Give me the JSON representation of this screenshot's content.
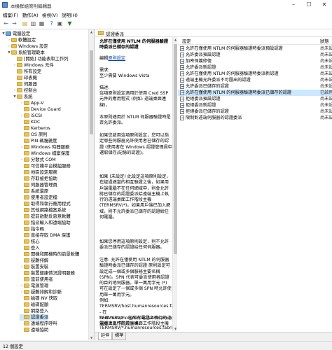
{
  "window": {
    "title": "本機群組原則編輯器"
  },
  "menu": [
    "檔案(F)",
    "動作(A)",
    "檢視(V)",
    "說明(H)"
  ],
  "tree": {
    "items": [
      {
        "label": "電腦設定",
        "level": 0,
        "exp": "▼",
        "icon": "pc"
      },
      {
        "label": "軟體設定",
        "level": 1,
        "exp": "›",
        "icon": "folder"
      },
      {
        "label": "Windows 設定",
        "level": 1,
        "exp": "›",
        "icon": "folder"
      },
      {
        "label": "系統管理範本",
        "level": 1,
        "exp": "▼",
        "icon": "folder"
      },
      {
        "label": "[開始] 功能表和工作列",
        "level": 2,
        "exp": "",
        "icon": "folder"
      },
      {
        "label": "Windows 元件",
        "level": 2,
        "exp": "›",
        "icon": "folder"
      },
      {
        "label": "所有設定",
        "level": 2,
        "exp": "",
        "icon": "folder"
      },
      {
        "label": "印表機",
        "level": 2,
        "exp": "",
        "icon": "folder"
      },
      {
        "label": "伺服器",
        "level": 2,
        "exp": "",
        "icon": "folder"
      },
      {
        "label": "控制台",
        "level": 2,
        "exp": "›",
        "icon": "folder"
      },
      {
        "label": "系統",
        "level": 2,
        "exp": "▼",
        "icon": "folder"
      },
      {
        "label": "App-V",
        "level": 3,
        "exp": "›",
        "icon": "folder"
      },
      {
        "label": "Device Guard",
        "level": 3,
        "exp": "",
        "icon": "folder"
      },
      {
        "label": "iSCSI",
        "level": 3,
        "exp": "›",
        "icon": "folder"
      },
      {
        "label": "KDC",
        "level": 3,
        "exp": "",
        "icon": "folder"
      },
      {
        "label": "Kerberos",
        "level": 3,
        "exp": "",
        "icon": "folder"
      },
      {
        "label": "OS 原則",
        "level": 3,
        "exp": "",
        "icon": "folder"
      },
      {
        "label": "PIN 碼複雜度",
        "level": 3,
        "exp": "",
        "icon": "folder"
      },
      {
        "label": "Windows 時間服務",
        "level": 3,
        "exp": "›",
        "icon": "folder"
      },
      {
        "label": "Windows 檔案保護",
        "level": 3,
        "exp": "",
        "icon": "folder"
      },
      {
        "label": "分散式 COM",
        "level": 3,
        "exp": "›",
        "icon": "folder"
      },
      {
        "label": "可信賴平台模組服務",
        "level": 3,
        "exp": "",
        "icon": "folder"
      },
      {
        "label": "地區設定服務",
        "level": 3,
        "exp": "",
        "icon": "folder"
      },
      {
        "label": "存取被拒協助",
        "level": 3,
        "exp": "",
        "icon": "folder"
      },
      {
        "label": "伺服器管理員",
        "level": 3,
        "exp": "",
        "icon": "folder"
      },
      {
        "label": "系統還原",
        "level": 3,
        "exp": "",
        "icon": "folder"
      },
      {
        "label": "使用者設定檔",
        "level": 3,
        "exp": "",
        "icon": "folder"
      },
      {
        "label": "取得和執行應用程式",
        "level": 3,
        "exp": "",
        "icon": "folder"
      },
      {
        "label": "其他網路檔案系統",
        "level": 3,
        "exp": "",
        "icon": "folder"
      },
      {
        "label": "提前啟動反惡意軟體",
        "level": 3,
        "exp": "",
        "icon": "folder"
      },
      {
        "label": "指派輸入和遠端協助",
        "level": 3,
        "exp": "",
        "icon": "folder"
      },
      {
        "label": "指令碼",
        "level": 3,
        "exp": "",
        "icon": "folder"
      },
      {
        "label": "直接存取 DMA 保護",
        "level": 3,
        "exp": "",
        "icon": "folder"
      },
      {
        "label": "核心",
        "level": 3,
        "exp": "",
        "icon": "folder"
      },
      {
        "label": "登入",
        "level": 3,
        "exp": "",
        "icon": "folder"
      },
      {
        "label": "開機和關機時的前景軟體",
        "level": 3,
        "exp": "",
        "icon": "folder"
      },
      {
        "label": "疑難排解",
        "level": 3,
        "exp": "",
        "icon": "folder"
      },
      {
        "label": "裝置安裝",
        "level": 3,
        "exp": "›",
        "icon": "folder"
      },
      {
        "label": "裝置健康情況證明服務",
        "level": 3,
        "exp": "",
        "icon": "folder"
      },
      {
        "label": "當前使用者",
        "level": 3,
        "exp": "",
        "icon": "folder"
      },
      {
        "label": "電源管理",
        "level": 3,
        "exp": "›",
        "icon": "folder"
      },
      {
        "label": "疑難排解和診斷",
        "level": 3,
        "exp": "›",
        "icon": "folder"
      },
      {
        "label": "磁碟 NV 快取",
        "level": 3,
        "exp": "",
        "icon": "folder"
      },
      {
        "label": "磁碟配額",
        "level": 3,
        "exp": "",
        "icon": "folder"
      },
      {
        "label": "網路登入",
        "level": 3,
        "exp": "",
        "icon": "folder"
      },
      {
        "label": "認證委派",
        "level": 3,
        "exp": "",
        "icon": "folder"
      },
      {
        "label": "遠端程序呼叫",
        "level": 3,
        "exp": "",
        "icon": "folder"
      },
      {
        "label": "遠端協助",
        "level": 3,
        "exp": "",
        "icon": "folder"
      }
    ]
  },
  "details": {
    "header": "認證委派",
    "policy_title": "允許在僅使用 NTLM 的伺服器驗證時委派已儲存的認證",
    "edit_prefix": "編輯",
    "edit_link": "原則設定",
    "requirements_label": "需求:",
    "requirements_value": "至少需要 Windows Vista",
    "description_label": "描述:",
    "paragraphs": [
      "這項原則設定適用於使用 Cred SSP 元件的應用程式 (例如: 遠端桌面連線)。",
      "本原則適用於 NTLM 伺服器驗證時是否允許委派。",
      "如果您啟用這項原則設定，您可以指定哪些伺服器允許使用者已儲存的認證 (使用者在 Windows 認證管理員中選取儲存/記憶的認證)。",
      "如果 (未設定) 此設定這項原則設定，在經過適當的相互驗證之後，如果用戶端電腦不在任何網域中，則會允許將已儲存的認證委派給遠端主機上執行的遠端桌面工作階段主機 (TERMSRV/*)。如果用戶端已加入網域，則不允許委派已儲存的認證給任何電腦。",
      "如果您停用這項原則設定，則不允許委派已儲存的認證給任何伺服器。",
      "注意: 允許在僅使用 NTLM 的伺服器驗證時委派已儲存的認證 原則設定可設定成一個或多個服務主要名稱 (SPN)。SPN 代表可委派使用者認證的目的地伺服器。單一萬用字元 (*) 可在設定了一個或多個 SPN 時允許使用單一萬用字元。",
      "例如:\nTERMSRV/host.humanresources.fabrikam.com - 在 host.humanresources.fabrikam.com 電腦上執行的遠端桌面工作階段主機",
      "TERMSRV/* - 在所有電腦上執行的遠端桌面工作階段主機。",
      "TERMSRV/*.humanresources.fabrikam.com -"
    ]
  },
  "list": {
    "col_setting": "設定",
    "col_state": "狀態",
    "items": [
      {
        "label": "允許在僅使用 NTLM 的伺服器驗證時委派預設認證",
        "state": "尚未設定"
      },
      {
        "label": "允許委派預設認證",
        "state": "尚未設定"
      },
      {
        "label": "加密保護修復",
        "state": "尚未設定"
      },
      {
        "label": "允許委派新認證",
        "state": "尚未設定"
      },
      {
        "label": "允許在僅使用 NTLM 的伺服器驗證時委派新認證",
        "state": "尚未設定"
      },
      {
        "label": "遠端主機允許委派不可匯出的認證",
        "state": "尚未設定"
      },
      {
        "label": "允許委派已儲存的認證",
        "state": "尚未設定"
      },
      {
        "label": "允許在僅使用 NTLM 的伺服器驗證時委派已儲存的認證",
        "state": "已啟用"
      },
      {
        "label": "拒絕委派預設認證",
        "state": "尚未設定"
      },
      {
        "label": "拒絕委派新認證",
        "state": "尚未設定"
      },
      {
        "label": "拒絕委派已儲存的認證",
        "state": "尚未設定"
      },
      {
        "label": "限制對遠端伺服器的認證委派",
        "state": "尚未設定"
      }
    ]
  },
  "tabs": [
    "延伸",
    "標準"
  ],
  "status": {
    "text": "12 個設定"
  },
  "colors": {
    "selection": "#cce8ff",
    "folder": "#e8c15a",
    "link": "#0645ad"
  }
}
